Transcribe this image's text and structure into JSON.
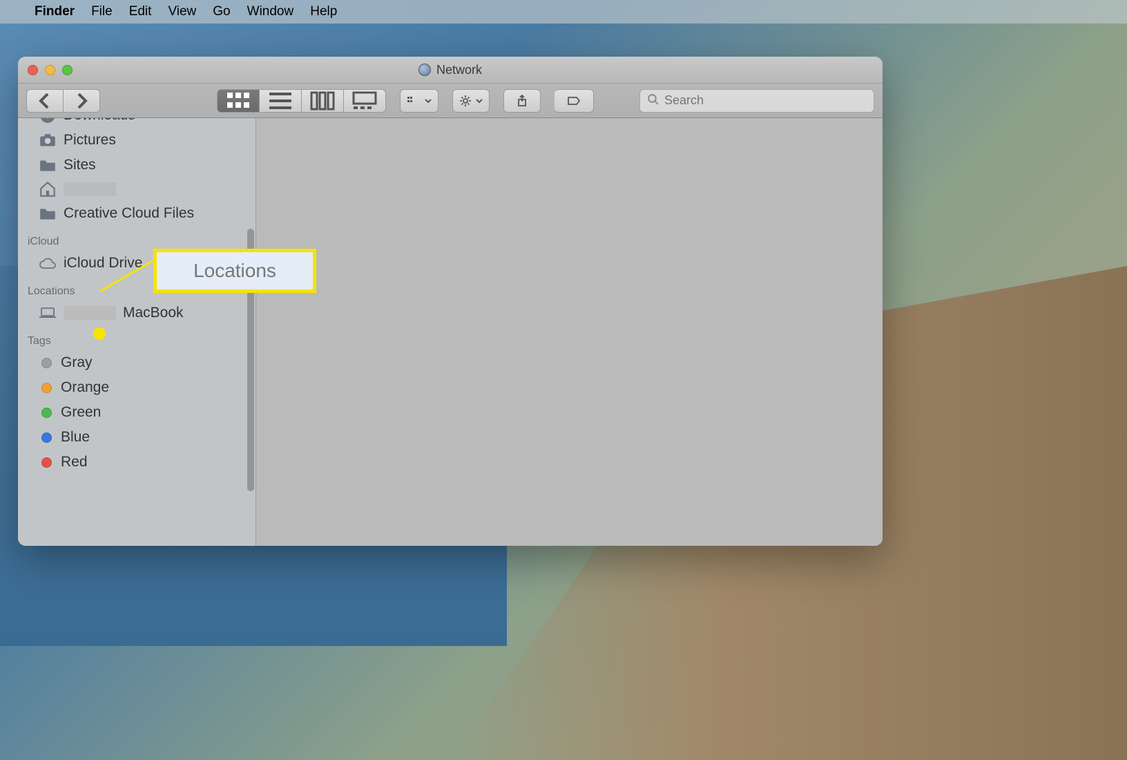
{
  "menu_bar": {
    "app_name": "Finder",
    "items": [
      "File",
      "Edit",
      "View",
      "Go",
      "Window",
      "Help"
    ]
  },
  "window": {
    "title": "Network"
  },
  "toolbar": {
    "search_placeholder": "Search"
  },
  "sidebar": {
    "favorites_partial": {
      "items": [
        {
          "icon": "downloads",
          "label": "Downloads"
        },
        {
          "icon": "camera",
          "label": "Pictures"
        },
        {
          "icon": "folder",
          "label": "Sites"
        },
        {
          "icon": "home",
          "label": ""
        },
        {
          "icon": "folder",
          "label": "Creative Cloud Files"
        }
      ]
    },
    "icloud": {
      "header": "iCloud",
      "items": [
        {
          "icon": "cloud",
          "label": "iCloud Drive"
        }
      ]
    },
    "locations": {
      "header": "Locations",
      "items": [
        {
          "icon": "laptop",
          "label_suffix": "MacBook"
        }
      ]
    },
    "tags": {
      "header": "Tags",
      "items": [
        {
          "color": "#9e9e9e",
          "label": "Gray"
        },
        {
          "color": "#f0a038",
          "label": "Orange"
        },
        {
          "color": "#4fb84f",
          "label": "Green"
        },
        {
          "color": "#3a78e0",
          "label": "Blue"
        },
        {
          "color": "#e05248",
          "label": "Red"
        }
      ]
    }
  },
  "callout": {
    "label": "Locations"
  }
}
